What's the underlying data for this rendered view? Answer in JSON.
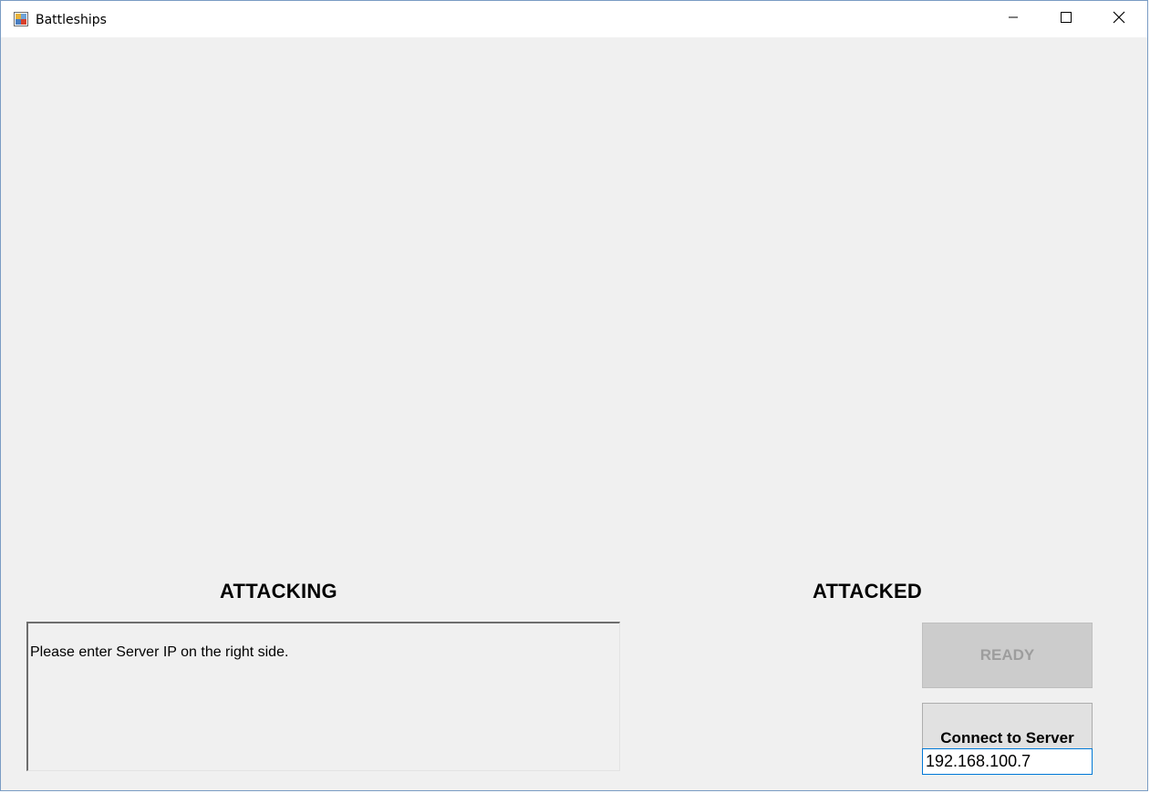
{
  "window": {
    "title": "Battleships",
    "app_icon": "battleships-app-icon",
    "controls": {
      "minimize_icon": "minimize-icon",
      "maximize_icon": "maximize-icon",
      "close_icon": "close-icon"
    }
  },
  "boards": {
    "attacking_label": "ATTACKING",
    "attacked_label": "ATTACKED"
  },
  "log": {
    "message": "Please enter Server IP on the right side."
  },
  "controls": {
    "ready_label": "READY",
    "ready_enabled": false,
    "connect_label": "Connect to Server",
    "server_ip_value": "192.168.100.7"
  },
  "colors": {
    "window_bg": "#f0f0f0",
    "titlebar_bg": "#ffffff",
    "window_border": "#7a9cc4",
    "focus_border": "#0078d7",
    "disabled_text": "#9d9d9d"
  }
}
